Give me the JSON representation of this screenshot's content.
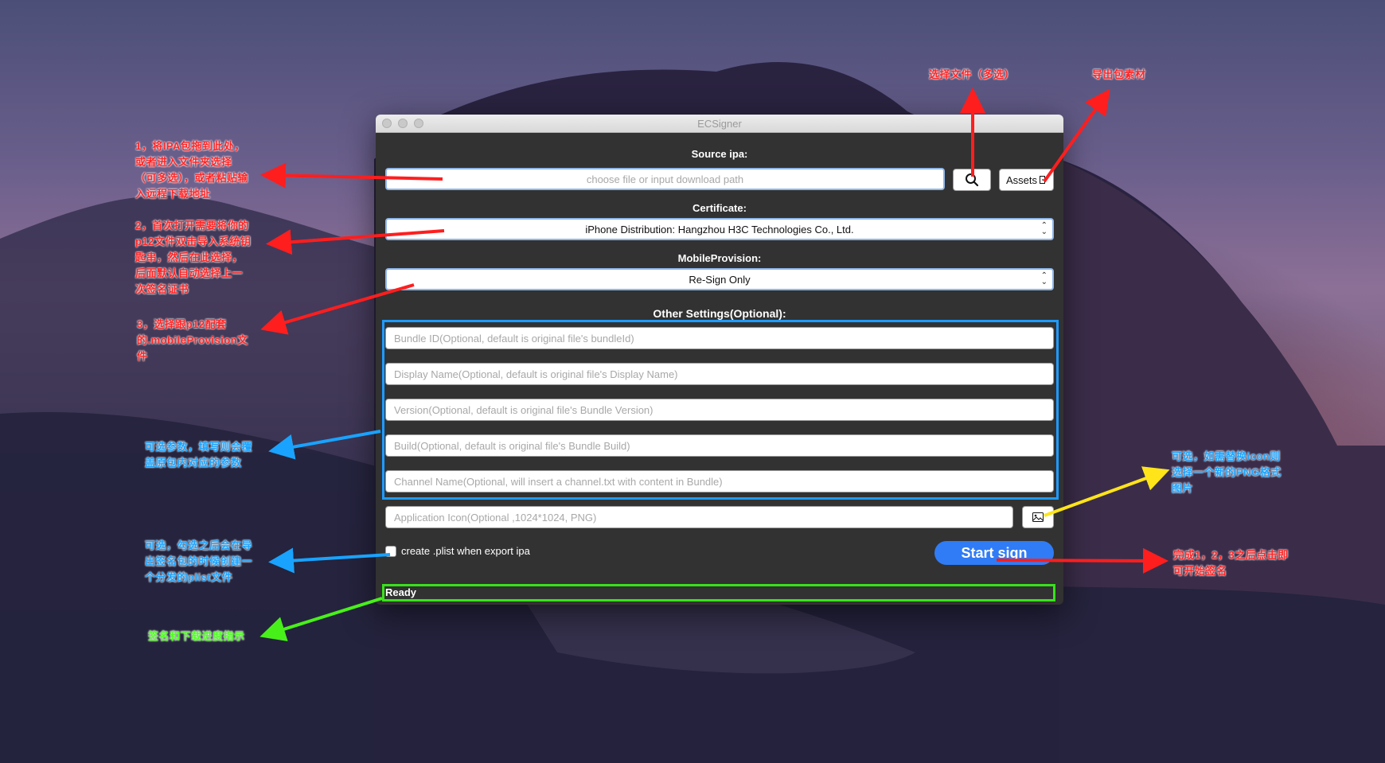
{
  "window": {
    "title": "ECSigner"
  },
  "source": {
    "label": "Source ipa:",
    "placeholder": "choose file or input download path",
    "assets_label": "Assets"
  },
  "certificate": {
    "label": "Certificate:",
    "value": "iPhone Distribution: Hangzhou H3C Technologies Co., Ltd."
  },
  "provision": {
    "label": "MobileProvision:",
    "value": "Re-Sign Only"
  },
  "settings": {
    "label": "Other Settings(Optional):",
    "bundle_id": "Bundle ID(Optional, default is original file's bundleId)",
    "display_name": "Display Name(Optional, default is original file's Display Name)",
    "version": "Version(Optional, default is original file's Bundle Version)",
    "build": "Build(Optional, default is original file's Bundle Build)",
    "channel": "Channel Name(Optional, will insert a channel.txt with content in Bundle)",
    "icon": "Application Icon(Optional ,1024*1024, PNG)"
  },
  "plist": {
    "label": "create .plist when export ipa",
    "checked": false
  },
  "start_label": "Start sign",
  "status": "Ready",
  "annotations": {
    "select_file": "选择文件（多选）",
    "export_assets": "导出包素材",
    "step1": "1，将IPA包拖到此处，或者进入文件夹选择（可多选），或者粘贴输入远程下载地址",
    "step2": "2，首次打开需要将你的p12文件双击导入系统钥匙串，然后在此选择，后面默认自动选择上一次签名证书",
    "step3": "3，选择跟p12配套的.mobileProvision文件",
    "optional_params": "可选参数，填写则会覆盖原包内对应的参数",
    "optional_plist": "可选，勾选之后会在导出签名包的时候创建一个分发的plist文件",
    "progress": "签名和下载进度指示",
    "optional_icon": "可选，如需替换icon则选择一个新的PNG格式图片",
    "finish": "完成1，2，3之后点击即可开始签名"
  }
}
